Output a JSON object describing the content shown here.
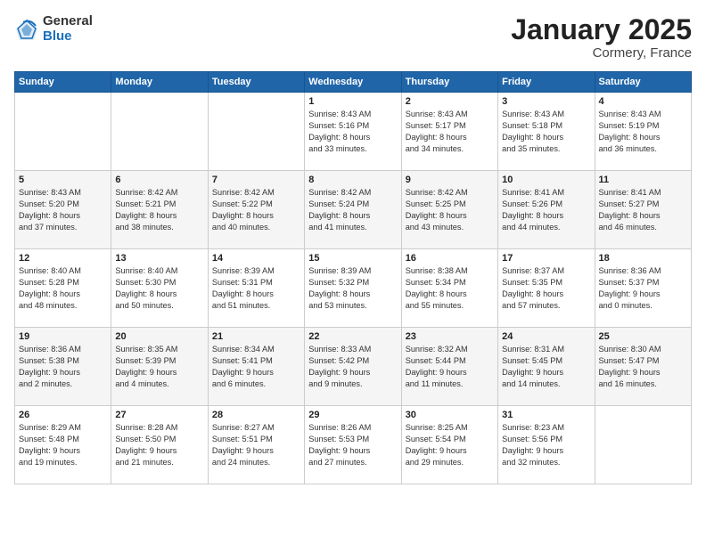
{
  "logo": {
    "general": "General",
    "blue": "Blue"
  },
  "title": "January 2025",
  "subtitle": "Cormery, France",
  "weekdays": [
    "Sunday",
    "Monday",
    "Tuesday",
    "Wednesday",
    "Thursday",
    "Friday",
    "Saturday"
  ],
  "weeks": [
    [
      {
        "day": "",
        "info": ""
      },
      {
        "day": "",
        "info": ""
      },
      {
        "day": "",
        "info": ""
      },
      {
        "day": "1",
        "info": "Sunrise: 8:43 AM\nSunset: 5:16 PM\nDaylight: 8 hours\nand 33 minutes."
      },
      {
        "day": "2",
        "info": "Sunrise: 8:43 AM\nSunset: 5:17 PM\nDaylight: 8 hours\nand 34 minutes."
      },
      {
        "day": "3",
        "info": "Sunrise: 8:43 AM\nSunset: 5:18 PM\nDaylight: 8 hours\nand 35 minutes."
      },
      {
        "day": "4",
        "info": "Sunrise: 8:43 AM\nSunset: 5:19 PM\nDaylight: 8 hours\nand 36 minutes."
      }
    ],
    [
      {
        "day": "5",
        "info": "Sunrise: 8:43 AM\nSunset: 5:20 PM\nDaylight: 8 hours\nand 37 minutes."
      },
      {
        "day": "6",
        "info": "Sunrise: 8:42 AM\nSunset: 5:21 PM\nDaylight: 8 hours\nand 38 minutes."
      },
      {
        "day": "7",
        "info": "Sunrise: 8:42 AM\nSunset: 5:22 PM\nDaylight: 8 hours\nand 40 minutes."
      },
      {
        "day": "8",
        "info": "Sunrise: 8:42 AM\nSunset: 5:24 PM\nDaylight: 8 hours\nand 41 minutes."
      },
      {
        "day": "9",
        "info": "Sunrise: 8:42 AM\nSunset: 5:25 PM\nDaylight: 8 hours\nand 43 minutes."
      },
      {
        "day": "10",
        "info": "Sunrise: 8:41 AM\nSunset: 5:26 PM\nDaylight: 8 hours\nand 44 minutes."
      },
      {
        "day": "11",
        "info": "Sunrise: 8:41 AM\nSunset: 5:27 PM\nDaylight: 8 hours\nand 46 minutes."
      }
    ],
    [
      {
        "day": "12",
        "info": "Sunrise: 8:40 AM\nSunset: 5:28 PM\nDaylight: 8 hours\nand 48 minutes."
      },
      {
        "day": "13",
        "info": "Sunrise: 8:40 AM\nSunset: 5:30 PM\nDaylight: 8 hours\nand 50 minutes."
      },
      {
        "day": "14",
        "info": "Sunrise: 8:39 AM\nSunset: 5:31 PM\nDaylight: 8 hours\nand 51 minutes."
      },
      {
        "day": "15",
        "info": "Sunrise: 8:39 AM\nSunset: 5:32 PM\nDaylight: 8 hours\nand 53 minutes."
      },
      {
        "day": "16",
        "info": "Sunrise: 8:38 AM\nSunset: 5:34 PM\nDaylight: 8 hours\nand 55 minutes."
      },
      {
        "day": "17",
        "info": "Sunrise: 8:37 AM\nSunset: 5:35 PM\nDaylight: 8 hours\nand 57 minutes."
      },
      {
        "day": "18",
        "info": "Sunrise: 8:36 AM\nSunset: 5:37 PM\nDaylight: 9 hours\nand 0 minutes."
      }
    ],
    [
      {
        "day": "19",
        "info": "Sunrise: 8:36 AM\nSunset: 5:38 PM\nDaylight: 9 hours\nand 2 minutes."
      },
      {
        "day": "20",
        "info": "Sunrise: 8:35 AM\nSunset: 5:39 PM\nDaylight: 9 hours\nand 4 minutes."
      },
      {
        "day": "21",
        "info": "Sunrise: 8:34 AM\nSunset: 5:41 PM\nDaylight: 9 hours\nand 6 minutes."
      },
      {
        "day": "22",
        "info": "Sunrise: 8:33 AM\nSunset: 5:42 PM\nDaylight: 9 hours\nand 9 minutes."
      },
      {
        "day": "23",
        "info": "Sunrise: 8:32 AM\nSunset: 5:44 PM\nDaylight: 9 hours\nand 11 minutes."
      },
      {
        "day": "24",
        "info": "Sunrise: 8:31 AM\nSunset: 5:45 PM\nDaylight: 9 hours\nand 14 minutes."
      },
      {
        "day": "25",
        "info": "Sunrise: 8:30 AM\nSunset: 5:47 PM\nDaylight: 9 hours\nand 16 minutes."
      }
    ],
    [
      {
        "day": "26",
        "info": "Sunrise: 8:29 AM\nSunset: 5:48 PM\nDaylight: 9 hours\nand 19 minutes."
      },
      {
        "day": "27",
        "info": "Sunrise: 8:28 AM\nSunset: 5:50 PM\nDaylight: 9 hours\nand 21 minutes."
      },
      {
        "day": "28",
        "info": "Sunrise: 8:27 AM\nSunset: 5:51 PM\nDaylight: 9 hours\nand 24 minutes."
      },
      {
        "day": "29",
        "info": "Sunrise: 8:26 AM\nSunset: 5:53 PM\nDaylight: 9 hours\nand 27 minutes."
      },
      {
        "day": "30",
        "info": "Sunrise: 8:25 AM\nSunset: 5:54 PM\nDaylight: 9 hours\nand 29 minutes."
      },
      {
        "day": "31",
        "info": "Sunrise: 8:23 AM\nSunset: 5:56 PM\nDaylight: 9 hours\nand 32 minutes."
      },
      {
        "day": "",
        "info": ""
      }
    ]
  ]
}
